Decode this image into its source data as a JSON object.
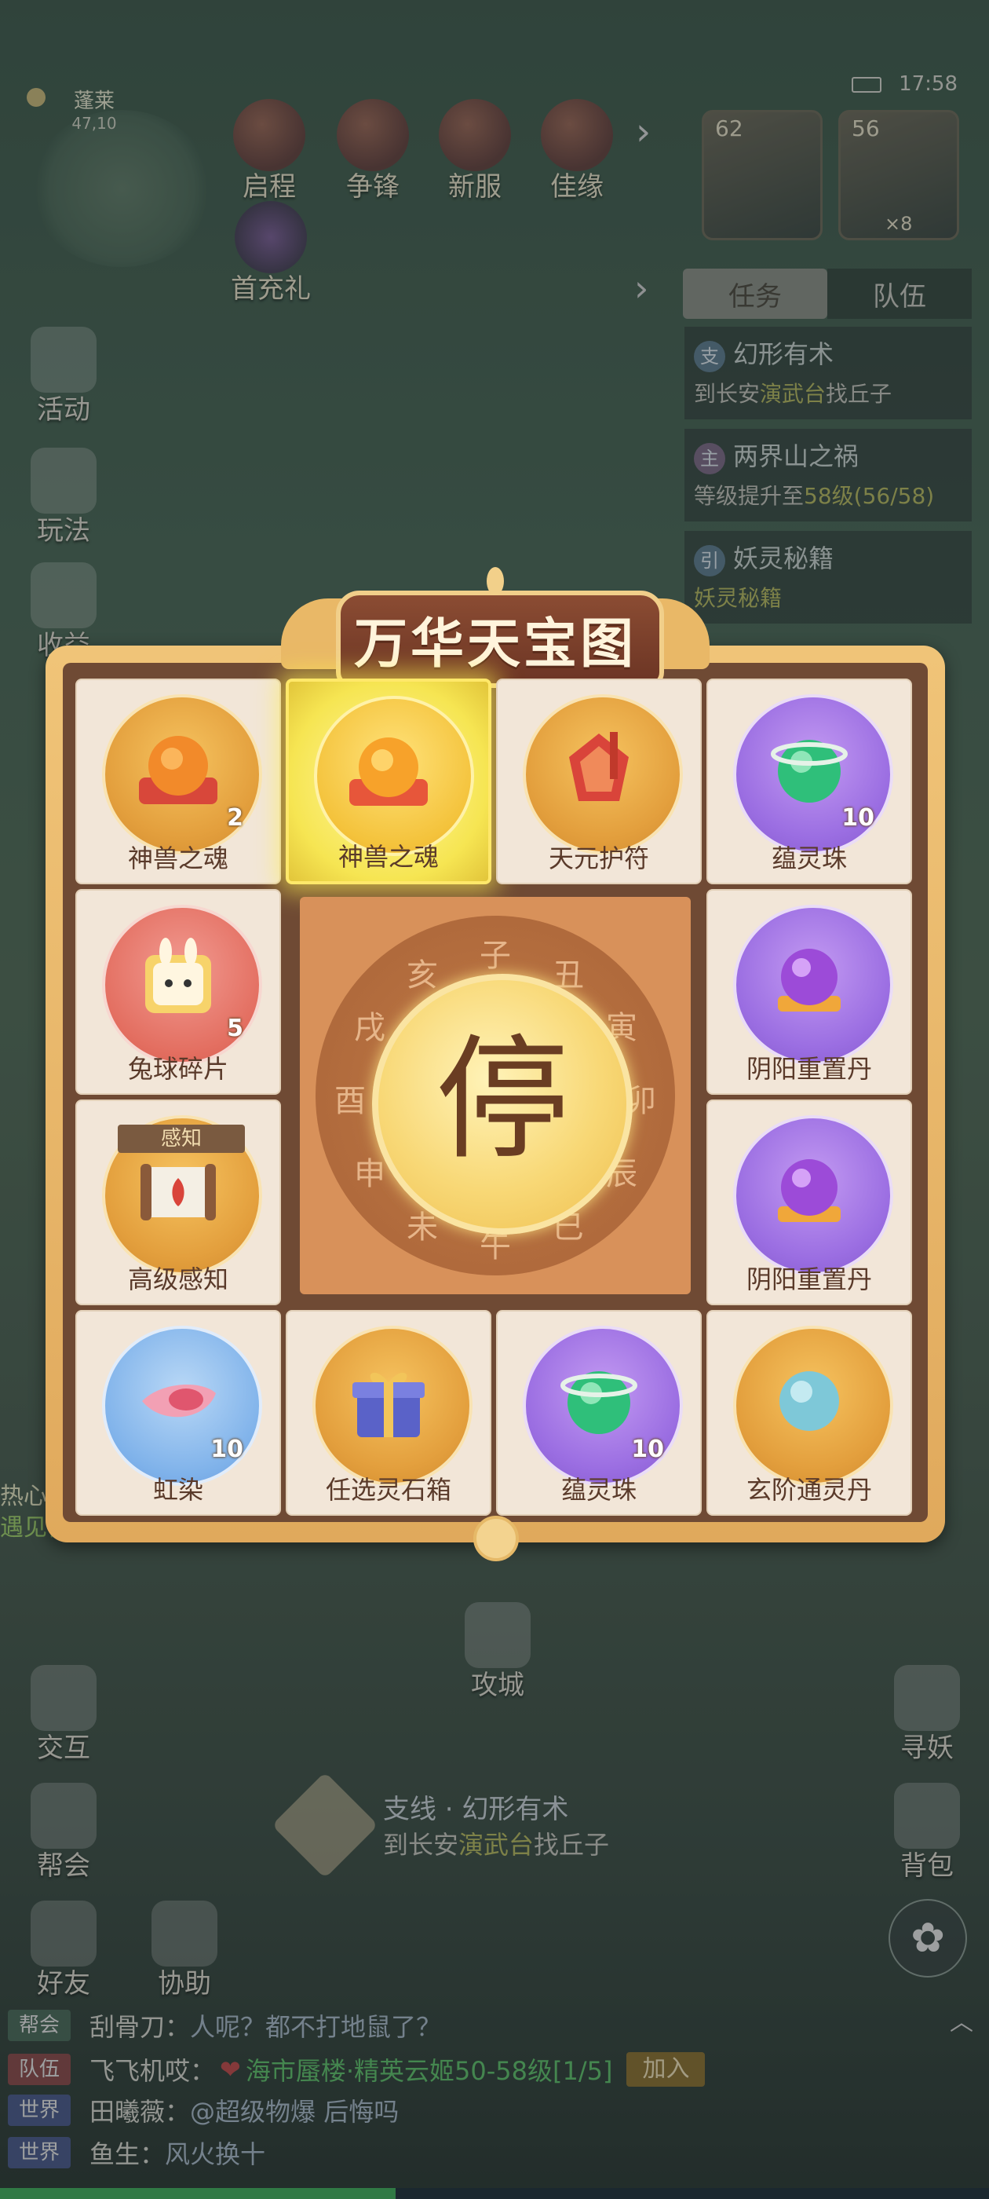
{
  "hud": {
    "location": "蓬莱",
    "coords": "47,10",
    "time": "17:58",
    "top_buttons": [
      {
        "label": "启程",
        "icon": "journey-icon"
      },
      {
        "label": "争锋",
        "icon": "battle-icon"
      },
      {
        "label": "新服",
        "icon": "new-server-icon"
      },
      {
        "label": "佳缘",
        "icon": "match-icon"
      }
    ],
    "first_recharge": "首充礼",
    "heroes": [
      {
        "level": "62"
      },
      {
        "level": "56",
        "multiplier": "×8"
      }
    ]
  },
  "side_menu": [
    "活动",
    "玩法",
    "收益"
  ],
  "task_panel": {
    "tabs": [
      "任务",
      "队伍"
    ],
    "tasks": [
      {
        "tag": "支",
        "title": "幻形有术",
        "desc_pre": "到长安",
        "desc_hl": "演武台",
        "desc_post": "找丘子"
      },
      {
        "tag": "主",
        "title": "两界山之祸",
        "desc_pre": "等级提升至",
        "desc_hl": "58级",
        "desc_post": "(56/58)"
      },
      {
        "tag": "引",
        "title": "妖灵秘籍",
        "desc_pre": "妖灵秘籍",
        "desc_hl": "",
        "desc_post": ""
      }
    ]
  },
  "modal": {
    "title": "万华天宝图",
    "stop_label": "停",
    "zodiac": [
      "子",
      "丑",
      "寅",
      "卯",
      "辰",
      "巳",
      "午",
      "未",
      "申",
      "酉",
      "戌",
      "亥"
    ],
    "items": [
      {
        "name": "神兽之魂",
        "count": "2",
        "disc": "gold"
      },
      {
        "name": "神兽之魂",
        "count": "",
        "disc": "selg",
        "selected": true
      },
      {
        "name": "天元护符",
        "count": "",
        "disc": "gold"
      },
      {
        "name": "蕴灵珠",
        "count": "10",
        "disc": "purple"
      },
      {
        "name": "兔球碎片",
        "count": "5",
        "disc": "pink"
      },
      {
        "name": "阴阳重置丹",
        "count": "",
        "disc": "purple"
      },
      {
        "name": "高级感知",
        "count": "",
        "disc": "gold",
        "badge": "感知"
      },
      {
        "name": "阴阳重置丹",
        "count": "",
        "disc": "purple"
      },
      {
        "name": "虹染",
        "count": "10",
        "disc": "blue"
      },
      {
        "name": "任选灵石箱",
        "count": "",
        "disc": "gold"
      },
      {
        "name": "蕴灵珠",
        "count": "10",
        "disc": "purple"
      },
      {
        "name": "玄阶通灵丹",
        "count": "",
        "disc": "gold"
      }
    ]
  },
  "world": {
    "siege": "攻城",
    "quest_title": "支线 · 幻形有术",
    "quest_pre": "到长安",
    "quest_hl": "演武台",
    "quest_post": "找丘子",
    "left_buttons": [
      "交互",
      "帮会",
      "好友",
      "协助"
    ],
    "right_buttons": [
      "寻妖",
      "背包"
    ],
    "side_snippets": [
      "热心助",
      "遇见你"
    ]
  },
  "chat": [
    {
      "channel": "帮会",
      "name": "刮骨刀：",
      "msg": "人呢？都不打地鼠了？",
      "type": "guild"
    },
    {
      "channel": "队伍",
      "name": "飞飞机哎：",
      "msg": "海市蜃楼·精英云姬50-58级[1/5]",
      "type": "team",
      "heart": true,
      "button": "加入"
    },
    {
      "channel": "世界",
      "name": "田曦薇：",
      "msg": "@超级物爆 后悔吗",
      "type": "world"
    },
    {
      "channel": "世界",
      "name": "鱼生：",
      "msg": "风火换十",
      "type": "world"
    }
  ]
}
